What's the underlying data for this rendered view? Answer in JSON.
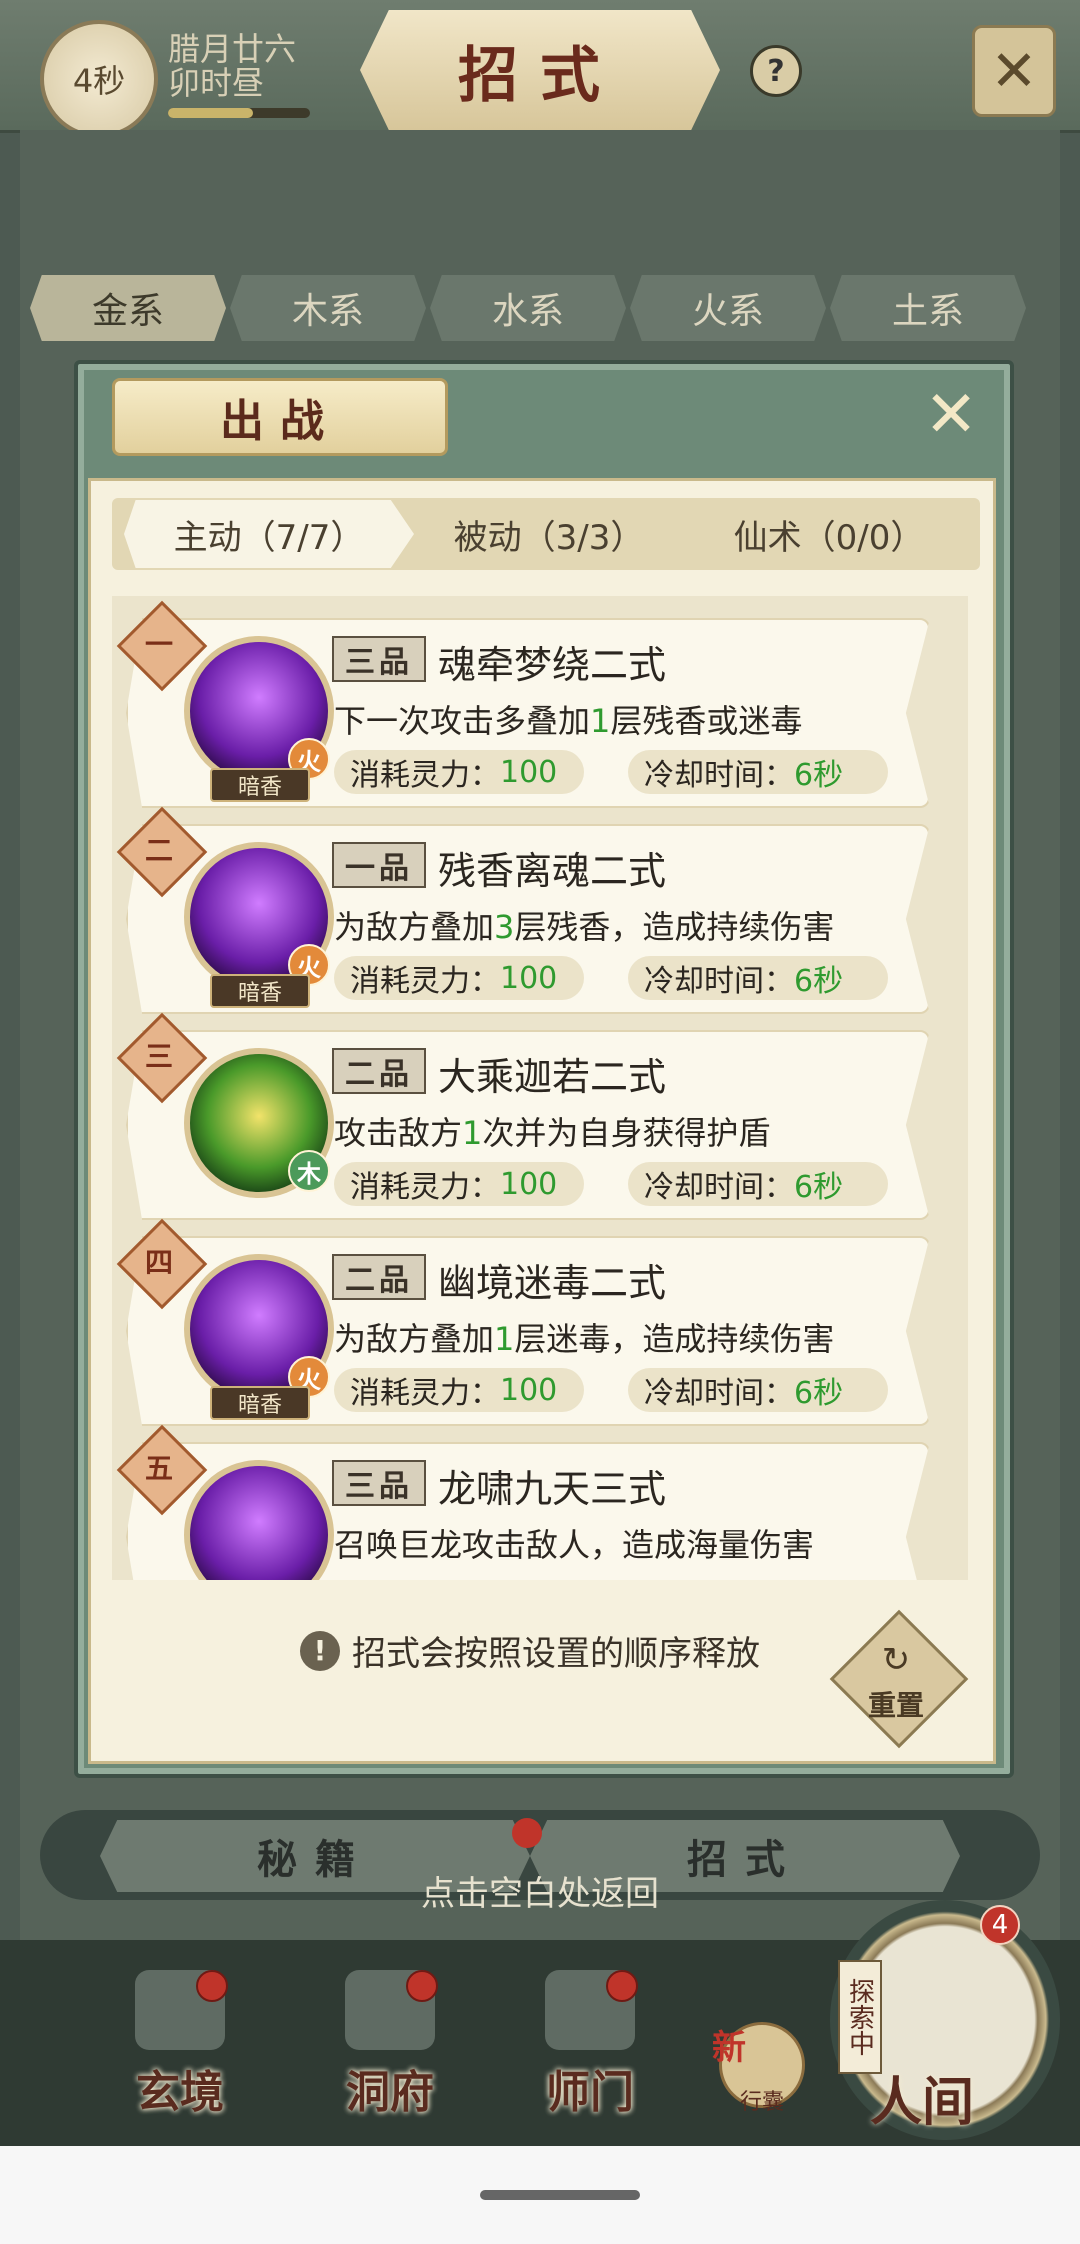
{
  "header": {
    "timer": "4秒",
    "date_line1": "腊月廿六",
    "date_line2": "卯时昼",
    "title": "招式",
    "help_glyph": "?",
    "time_progress": 0.6
  },
  "element_tabs": [
    "金系",
    "木系",
    "水系",
    "火系",
    "土系"
  ],
  "modal": {
    "title": "出战",
    "sub_tabs": [
      "主动（7/7）",
      "被动（3/3）",
      "仙术（0/0）"
    ],
    "skills": [
      {
        "order": "一",
        "grade": "三品",
        "name": "魂牵梦绕二式",
        "desc_before": "下一次攻击多叠加",
        "desc_num": "1",
        "desc_after": "层残香或迷毒",
        "cost_label": "消耗灵力：",
        "cost": "100",
        "cd_label": "冷却时间：",
        "cd": "6秒",
        "element": "火",
        "school": "暗香",
        "icon": "purple-swirl-icon"
      },
      {
        "order": "二",
        "grade": "一品",
        "name": "残香离魂二式",
        "desc_before": "为敌方叠加",
        "desc_num": "3",
        "desc_after": "层残香，造成持续伤害",
        "cost_label": "消耗灵力：",
        "cost": "100",
        "cd_label": "冷却时间：",
        "cd": "6秒",
        "element": "火",
        "school": "暗香",
        "icon": "purple-figure-icon"
      },
      {
        "order": "三",
        "grade": "二品",
        "name": "大乘迦若二式",
        "desc_before": "攻击敌方",
        "desc_num": "1",
        "desc_after": "次并为自身获得护盾",
        "cost_label": "消耗灵力：",
        "cost": "100",
        "cd_label": "冷却时间：",
        "cd": "6秒",
        "element": "木",
        "school": "",
        "icon": "green-staff-icon"
      },
      {
        "order": "四",
        "grade": "二品",
        "name": "幽境迷毒二式",
        "desc_before": "为敌方叠加",
        "desc_num": "1",
        "desc_after": "层迷毒，造成持续伤害",
        "cost_label": "消耗灵力：",
        "cost": "100",
        "cd_label": "冷却时间：",
        "cd": "6秒",
        "element": "火",
        "school": "暗香",
        "icon": "purple-sword-icon"
      },
      {
        "order": "五",
        "grade": "三品",
        "name": "龙啸九天三式",
        "desc_before": "召唤巨龙攻击敌人，造成海量伤害",
        "desc_num": "",
        "desc_after": "",
        "cost_label": "",
        "cost": "",
        "cd_label": "",
        "cd": "",
        "element": "",
        "school": "",
        "icon": "purple-dragon-icon"
      }
    ],
    "hint": "招式会按照设置的顺序释放",
    "reset_label": "重置"
  },
  "book_tabs": [
    "秘籍",
    "招式"
  ],
  "return_hint": "点击空白处返回",
  "bottom_nav": [
    {
      "label": "玄境",
      "icon": "scroll-icon"
    },
    {
      "label": "洞府",
      "icon": "lantern-icon"
    },
    {
      "label": "师门",
      "icon": "banner-icon"
    }
  ],
  "pouch": {
    "new_label": "新",
    "label": "行囊"
  },
  "renjian": {
    "label": "人间",
    "explore": "探索中",
    "badge": "4"
  }
}
